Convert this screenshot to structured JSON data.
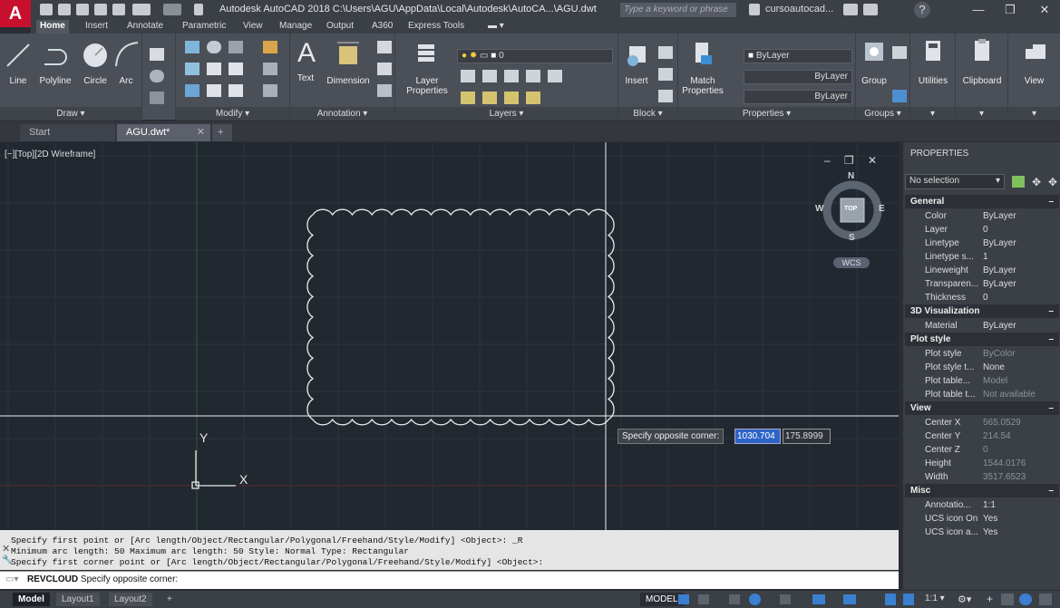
{
  "title_bar": {
    "app_logo": "A",
    "title": "Autodesk AutoCAD 2018   C:\\Users\\AGU\\AppData\\Local\\Autodesk\\AutoCA...\\AGU.dwt",
    "search_placeholder": "Type a keyword or phrase",
    "user": "cursoautocad...",
    "help": "?",
    "minimize": "—",
    "restore": "❐",
    "close": "✕"
  },
  "ribbon_tabs": [
    "Home",
    "Insert",
    "Annotate",
    "Parametric",
    "View",
    "Manage",
    "Output",
    "A360",
    "Express Tools"
  ],
  "ribbon": {
    "draw": {
      "title": "Draw ▾",
      "tools": [
        "Line",
        "Polyline",
        "Circle",
        "Arc"
      ]
    },
    "modify": {
      "title": "Modify ▾"
    },
    "annotation": {
      "title": "Annotation ▾",
      "tools": [
        "Text",
        "Dimension"
      ]
    },
    "layers": {
      "title": "Layers ▾",
      "tool": "Layer",
      "tool2": "Properties",
      "current_layer": "0"
    },
    "block": {
      "title": "Block ▾",
      "tool": "Insert"
    },
    "properties": {
      "title": "Properties ▾",
      "tool": "Match",
      "tool2": "Properties",
      "color": "ByLayer",
      "linetype": "ByLayer",
      "lineweight": "ByLayer"
    },
    "groups": {
      "title": "Groups ▾",
      "tool": "Group"
    },
    "utilities": {
      "tool": "Utilities"
    },
    "clipboard": {
      "tool": "Clipboard"
    },
    "view": {
      "tool": "View"
    }
  },
  "doc_tabs": {
    "start": "Start",
    "active": "AGU.dwt*",
    "close": "✕",
    "new": "+"
  },
  "drawing": {
    "viewport_label": "[−][Top][2D Wireframe]",
    "viewport_controls": "– ❐ ✕",
    "viewcube": {
      "n": "N",
      "s": "S",
      "e": "E",
      "w": "W",
      "face": "TOP",
      "wcs": "WCS"
    },
    "ucs": {
      "x": "X",
      "y": "Y"
    },
    "tooltip": "Specify opposite corner:",
    "input_x": "1030.704",
    "input_y": "175.8999"
  },
  "command": {
    "history": [
      "Specify first point or [Arc length/Object/Rectangular/Polygonal/Freehand/Style/Modify] <Object>: _R",
      "Minimum arc length: 50   Maximum arc length: 50   Style: Normal   Type: Rectangular",
      "Specify first corner point or [Arc length/Object/Rectangular/Polygonal/Freehand/Style/Modify] <Object>:"
    ],
    "prompt_cmd": "REVCLOUD",
    "prompt_text": " Specify opposite corner:"
  },
  "status": {
    "tabs": [
      "Model",
      "Layout1",
      "Layout2"
    ],
    "add": "+",
    "model_label": "MODEL",
    "scale": "1:1 ▾"
  },
  "properties": {
    "title": "PROPERTIES",
    "selection": "No selection",
    "sections": {
      "general": "General",
      "viz": "3D Visualization",
      "plot": "Plot style",
      "view": "View",
      "misc": "Misc"
    },
    "general": [
      {
        "k": "Color",
        "v": "ByLayer"
      },
      {
        "k": "Layer",
        "v": "0"
      },
      {
        "k": "Linetype",
        "v": "ByLayer"
      },
      {
        "k": "Linetype s...",
        "v": "1"
      },
      {
        "k": "Lineweight",
        "v": "ByLayer"
      },
      {
        "k": "Transparen...",
        "v": "ByLayer"
      },
      {
        "k": "Thickness",
        "v": "0"
      }
    ],
    "viz": [
      {
        "k": "Material",
        "v": "ByLayer"
      }
    ],
    "plot": [
      {
        "k": "Plot style",
        "v": "ByColor"
      },
      {
        "k": "Plot style t...",
        "v": "None"
      },
      {
        "k": "Plot table...",
        "v": "Model"
      },
      {
        "k": "Plot table t...",
        "v": "Not available"
      }
    ],
    "view": [
      {
        "k": "Center X",
        "v": "565.0529"
      },
      {
        "k": "Center Y",
        "v": "214.54"
      },
      {
        "k": "Center Z",
        "v": "0"
      },
      {
        "k": "Height",
        "v": "1544.0176"
      },
      {
        "k": "Width",
        "v": "3517.6523"
      }
    ],
    "misc": [
      {
        "k": "Annotatio...",
        "v": "1:1"
      },
      {
        "k": "UCS icon On",
        "v": "Yes"
      },
      {
        "k": "UCS icon a...",
        "v": "Yes"
      }
    ]
  }
}
